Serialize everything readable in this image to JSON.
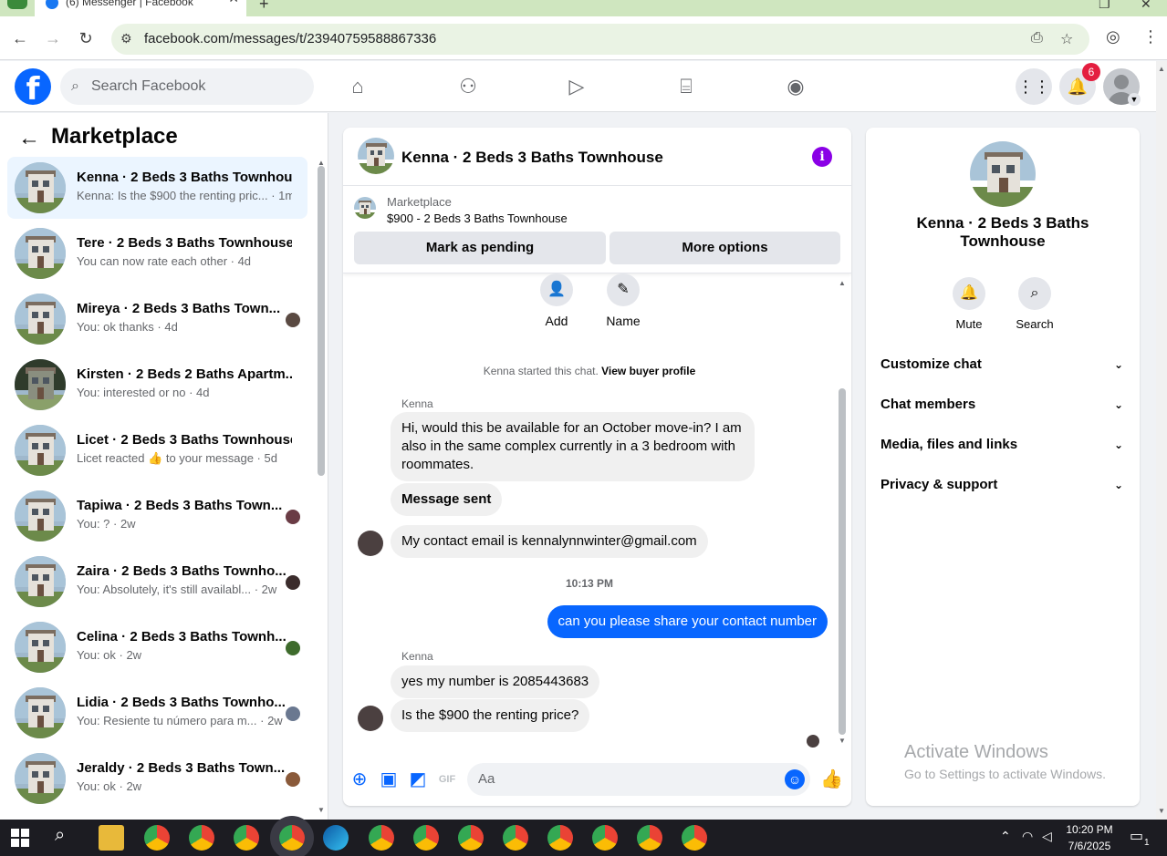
{
  "browser": {
    "tab_title": "(6) Messenger | Facebook",
    "url": "facebook.com/messages/t/23940759588867336"
  },
  "header": {
    "search_placeholder": "Search Facebook",
    "notification_count": "6",
    "brand_color": "#0866ff"
  },
  "left_panel": {
    "title": "Marketplace",
    "conversations": [
      {
        "name": "Kenna · 2 Beds 3 Baths Townhou...",
        "snippet": "Kenna: Is the $900 the renting pric... · 1m",
        "active": true
      },
      {
        "name": "Tere · 2 Beds 3 Baths Townhouse",
        "snippet": "You can now rate each other · 4d"
      },
      {
        "name": "Mireya · 2 Beds 3 Baths Town...",
        "snippet": "You: ok thanks · 4d"
      },
      {
        "name": "Kirsten · 2 Beds 2 Baths Apartm...",
        "snippet": "You: interested or no · 4d"
      },
      {
        "name": "Licet · 2 Beds 3 Baths Townhouse",
        "snippet": "Licet reacted 👍 to your message · 5d"
      },
      {
        "name": "Tapiwa · 2 Beds 3 Baths Town...",
        "snippet": "You: ? · 2w"
      },
      {
        "name": "Zaira · 2 Beds 3 Baths Townho...",
        "snippet": "You: Absolutely, it's still availabl... · 2w"
      },
      {
        "name": "Celina · 2 Beds 3 Baths Townh...",
        "snippet": "You: ok · 2w"
      },
      {
        "name": "Lidia · 2 Beds 3 Baths Townho...",
        "snippet": "You: Resiente tu número para m... · 2w"
      },
      {
        "name": "Jeraldy · 2 Beds 3 Baths Town...",
        "snippet": "You: ok · 2w"
      }
    ]
  },
  "chat": {
    "title": "Kenna · 2 Beds 3 Baths Townhouse",
    "marketplace_label": "Marketplace",
    "listing": "$900 - 2 Beds 3 Baths Townhouse",
    "mark_pending": "Mark as pending",
    "more_options": "More options",
    "actions": {
      "add": "Add",
      "name": "Name"
    },
    "started_note": "Kenna started this chat.",
    "view_buyer": "View buyer profile",
    "sender1": "Kenna",
    "msg1": "Hi, would this be available for an October move-in? I am also in the same complex currently in a 3 bedroom with roommates.",
    "msg2": "Message sent",
    "msg3": "My contact email is kennalynnwinter@gmail.com",
    "timestamp": "10:13 PM",
    "msg_me": "can you please share your contact number",
    "sender2": "Kenna",
    "msg4": "yes my number is 2085443683",
    "msg5": "Is the $900 the renting price?",
    "composer_placeholder": "Aa",
    "composer_gif": "GIF"
  },
  "right_panel": {
    "name": "Kenna · 2 Beds 3 Baths Townhouse",
    "mute": "Mute",
    "search": "Search",
    "rows": [
      "Customize chat",
      "Chat members",
      "Media, files and links",
      "Privacy & support"
    ],
    "activate_title": "Activate Windows",
    "activate_sub": "Go to Settings to activate Windows."
  },
  "taskbar": {
    "time": "10:20 PM",
    "date": "7/6/2025",
    "notif_count": "1"
  }
}
